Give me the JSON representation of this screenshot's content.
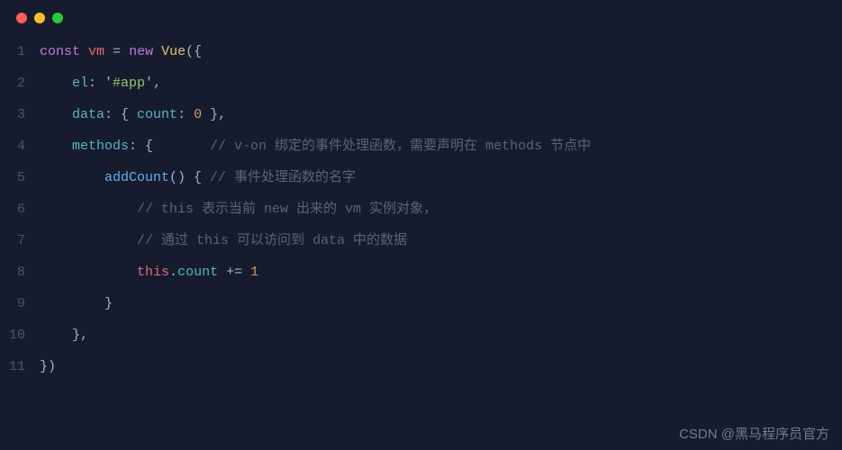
{
  "lines": [
    {
      "n": "1",
      "tokens": [
        {
          "t": "const",
          "c": "kw"
        },
        {
          "t": " ",
          "c": "punct"
        },
        {
          "t": "vm",
          "c": "var"
        },
        {
          "t": " = ",
          "c": "punct"
        },
        {
          "t": "new",
          "c": "kw"
        },
        {
          "t": " ",
          "c": "punct"
        },
        {
          "t": "Vue",
          "c": "cls"
        },
        {
          "t": "({",
          "c": "punct"
        }
      ]
    },
    {
      "n": "2",
      "tokens": [
        {
          "t": "    ",
          "c": "punct"
        },
        {
          "t": "el",
          "c": "prop"
        },
        {
          "t": ": ",
          "c": "punct"
        },
        {
          "t": "'#app'",
          "c": "str"
        },
        {
          "t": ",",
          "c": "punct"
        }
      ]
    },
    {
      "n": "3",
      "tokens": [
        {
          "t": "    ",
          "c": "punct"
        },
        {
          "t": "data",
          "c": "prop"
        },
        {
          "t": ": { ",
          "c": "punct"
        },
        {
          "t": "count",
          "c": "prop"
        },
        {
          "t": ": ",
          "c": "punct"
        },
        {
          "t": "0",
          "c": "num"
        },
        {
          "t": " },",
          "c": "punct"
        }
      ]
    },
    {
      "n": "4",
      "tokens": [
        {
          "t": "    ",
          "c": "punct"
        },
        {
          "t": "methods",
          "c": "prop"
        },
        {
          "t": ": {       ",
          "c": "punct"
        },
        {
          "t": "// v-on 绑定的事件处理函数，需要声明在 methods 节点中",
          "c": "comment"
        }
      ]
    },
    {
      "n": "5",
      "tokens": [
        {
          "t": "        ",
          "c": "punct"
        },
        {
          "t": "addCount",
          "c": "fn"
        },
        {
          "t": "() { ",
          "c": "punct"
        },
        {
          "t": "// 事件处理函数的名字",
          "c": "comment"
        }
      ]
    },
    {
      "n": "6",
      "tokens": [
        {
          "t": "            ",
          "c": "punct"
        },
        {
          "t": "// this 表示当前 new 出来的 vm 实例对象，",
          "c": "comment"
        }
      ]
    },
    {
      "n": "7",
      "tokens": [
        {
          "t": "            ",
          "c": "punct"
        },
        {
          "t": "// 通过 this 可以访问到 data 中的数据",
          "c": "comment"
        }
      ]
    },
    {
      "n": "8",
      "tokens": [
        {
          "t": "            ",
          "c": "punct"
        },
        {
          "t": "this",
          "c": "this"
        },
        {
          "t": ".",
          "c": "punct"
        },
        {
          "t": "count",
          "c": "prop"
        },
        {
          "t": " += ",
          "c": "punct"
        },
        {
          "t": "1",
          "c": "num"
        }
      ]
    },
    {
      "n": "9",
      "tokens": [
        {
          "t": "        }",
          "c": "punct"
        }
      ]
    },
    {
      "n": "10",
      "tokens": [
        {
          "t": "    },",
          "c": "punct"
        }
      ]
    },
    {
      "n": "11",
      "tokens": [
        {
          "t": "})",
          "c": "punct"
        }
      ]
    }
  ],
  "watermark": "CSDN @黑马程序员官方"
}
